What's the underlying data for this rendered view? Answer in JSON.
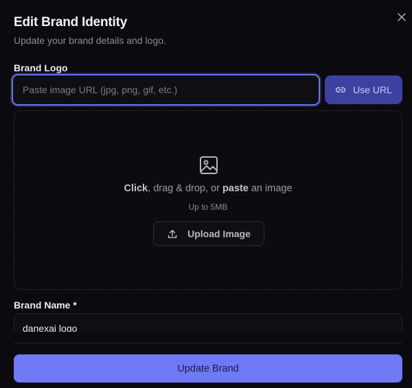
{
  "modal": {
    "title": "Edit Brand Identity",
    "subtitle": "Update your brand details and logo.",
    "close_icon": "close-icon"
  },
  "logo": {
    "label": "Brand Logo",
    "url_input": {
      "value": "",
      "placeholder": "Paste image URL (jpg, png, gif, etc.)"
    },
    "use_url_button": {
      "label": "Use URL",
      "icon": "link-icon"
    },
    "dropzone": {
      "icon": "image-icon",
      "text_click": "Click",
      "text_middle": ", drag & drop, or ",
      "text_paste": "paste",
      "text_end": " an image",
      "limit": "Up to 5MB",
      "upload_button": {
        "label": "Upload Image",
        "icon": "upload-icon"
      }
    }
  },
  "name": {
    "label": "Brand Name *",
    "value": "danexai logo"
  },
  "submit": {
    "label": "Update Brand"
  },
  "colors": {
    "accent": "#6f78f5",
    "focus_border": "#6b74e8",
    "background": "#0b0b0f"
  }
}
